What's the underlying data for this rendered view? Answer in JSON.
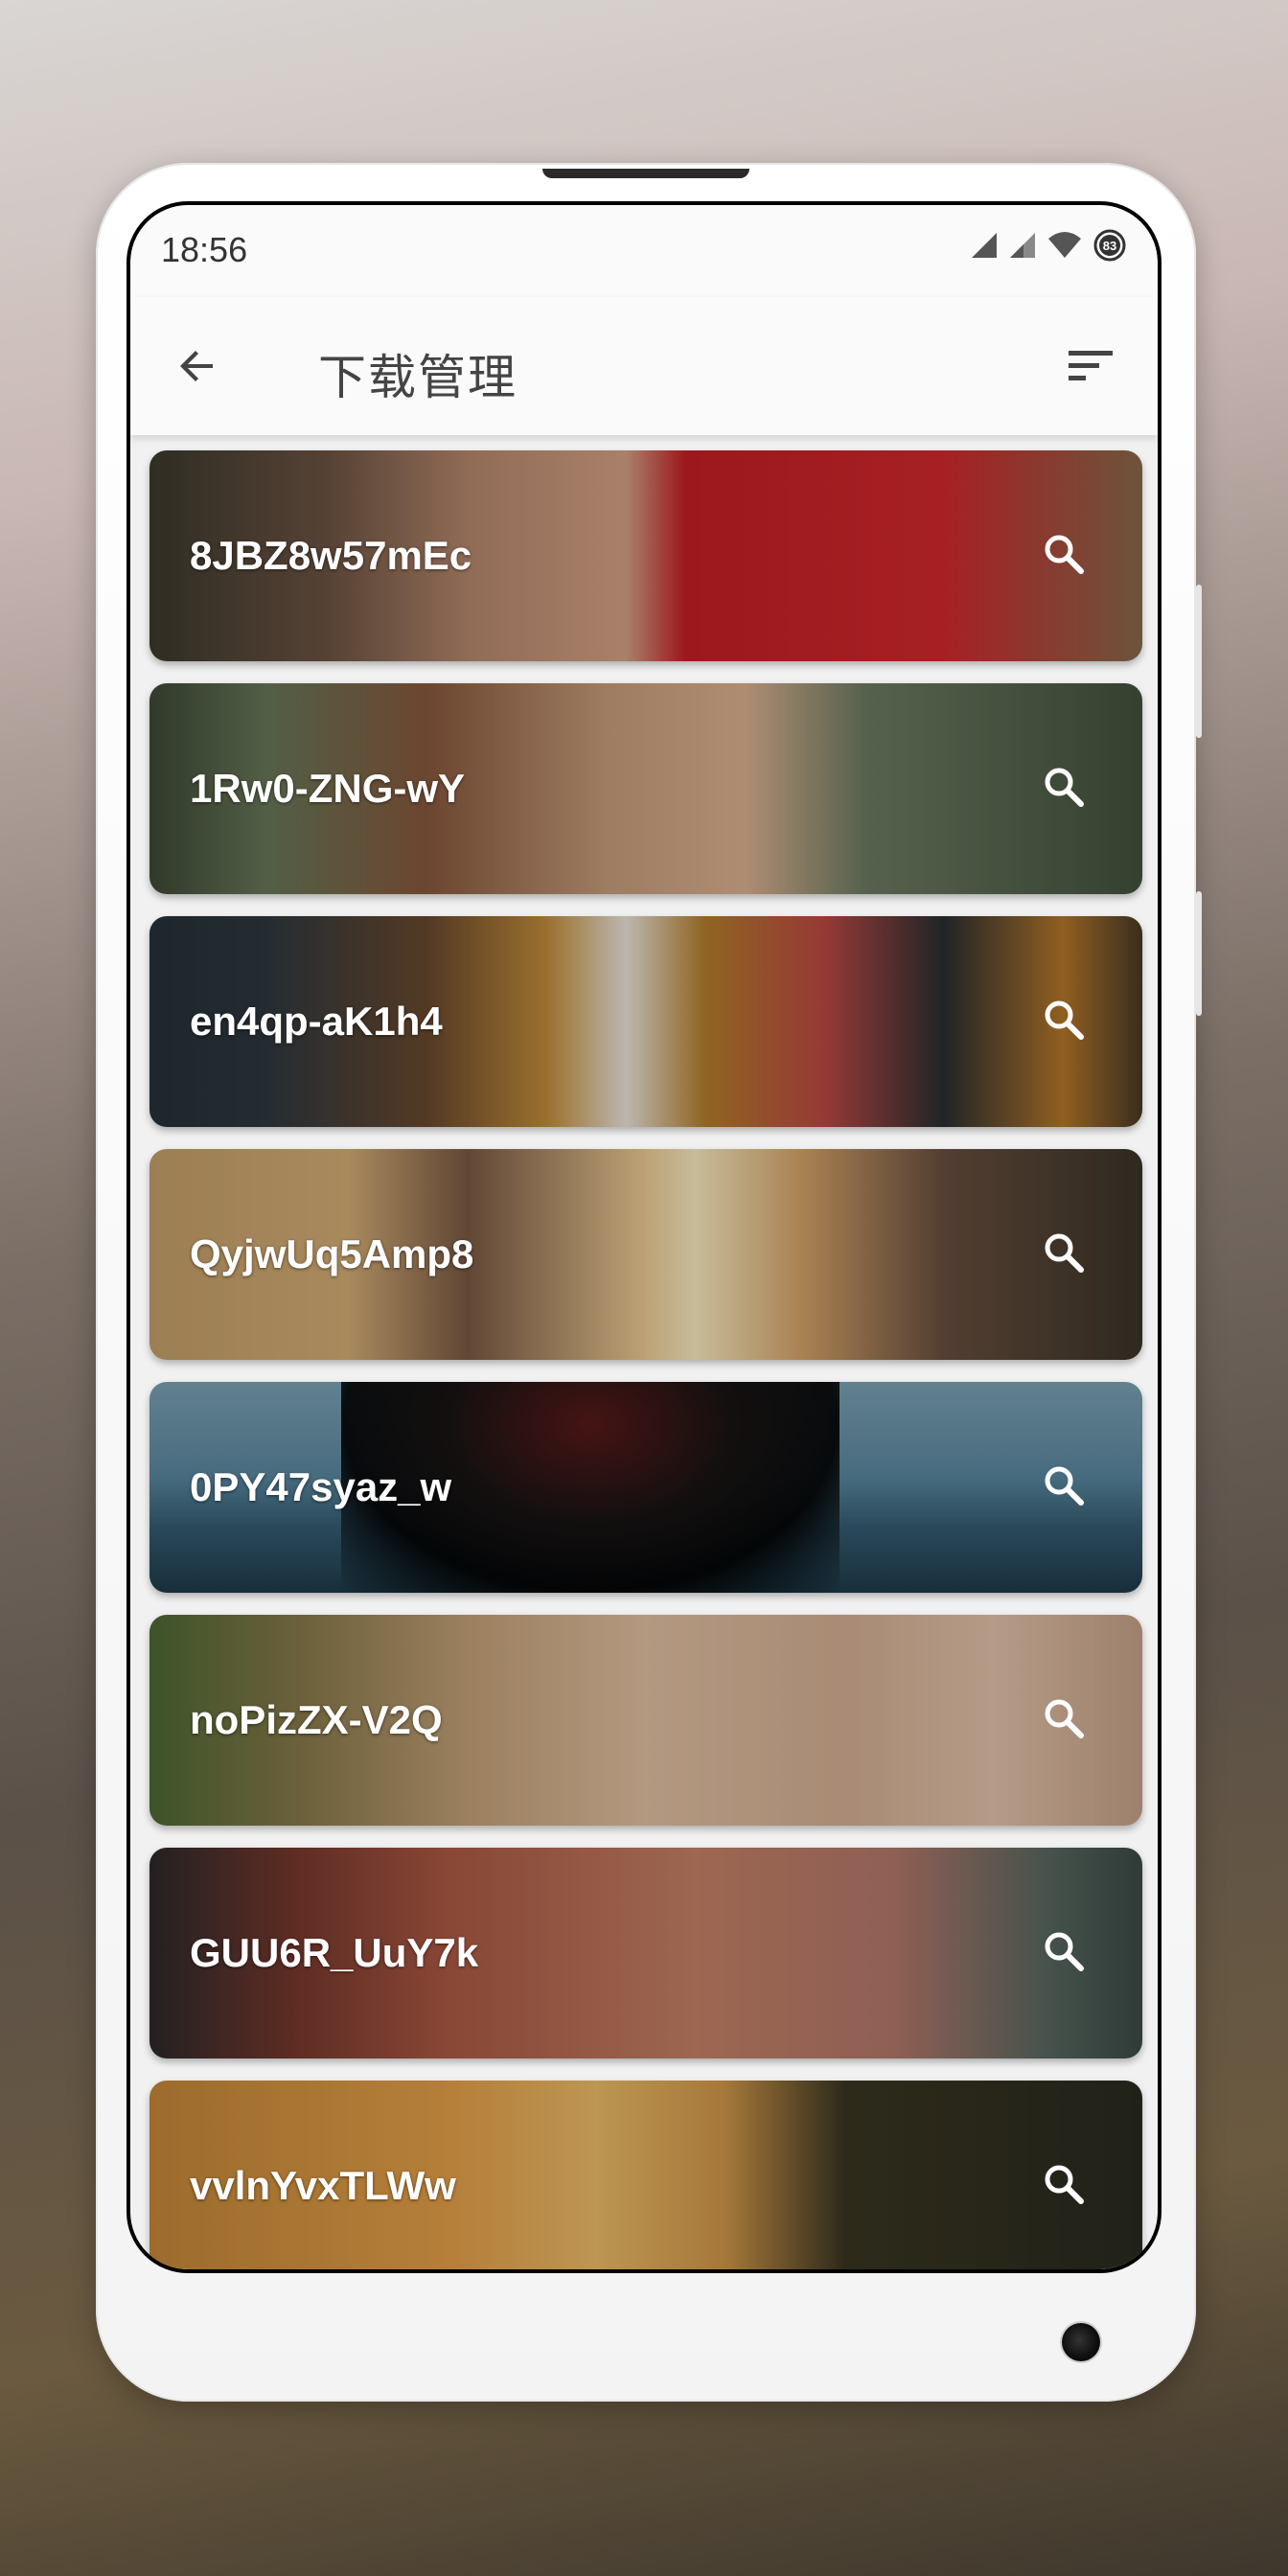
{
  "status_bar": {
    "time": "18:56",
    "battery_level": "83",
    "icons": [
      "signal-icon",
      "signal-icon",
      "wifi-icon",
      "battery-icon"
    ]
  },
  "toolbar": {
    "back_icon": "arrow-back-icon",
    "title": "下载管理",
    "sort_icon": "sort-icon"
  },
  "list": {
    "items": [
      {
        "label": "8JBZ8w57mEc",
        "action_icon": "search-icon"
      },
      {
        "label": "1Rw0-ZNG-wY",
        "action_icon": "search-icon"
      },
      {
        "label": "en4qp-aK1h4",
        "action_icon": "search-icon"
      },
      {
        "label": "QyjwUq5Amp8",
        "action_icon": "search-icon"
      },
      {
        "label": "0PY47syaz_w",
        "action_icon": "search-icon"
      },
      {
        "label": "noPizZX-V2Q",
        "action_icon": "search-icon"
      },
      {
        "label": "GUU6R_UuY7k",
        "action_icon": "search-icon"
      },
      {
        "label": "vvlnYvxTLWw",
        "action_icon": "search-icon"
      }
    ]
  },
  "colors": {
    "toolbar_bg": "#fafafa",
    "list_bg": "#f1f1f1",
    "label_text": "#ffffff",
    "title_text": "#444444"
  }
}
